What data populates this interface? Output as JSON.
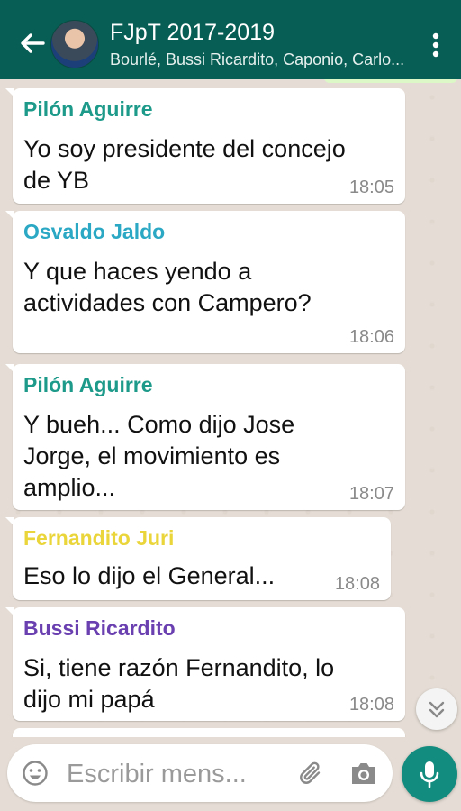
{
  "header": {
    "title": "FJpT 2017-2019",
    "subtitle": "Bourlé, Bussi Ricardito, Caponio, Carlo..."
  },
  "messages": [
    {
      "sender": "Pilón Aguirre",
      "sender_color": "#1e9a8a",
      "text_lines": [
        "Yo soy presidente del concejo",
        "de YB"
      ],
      "time": "18:05"
    },
    {
      "sender": "Osvaldo Jaldo",
      "sender_color": "#2aa8c4",
      "text_lines": [
        "Y que haces yendo a",
        "actividades con Campero?"
      ],
      "time": "18:06"
    },
    {
      "sender": "Pilón Aguirre",
      "sender_color": "#1e9a8a",
      "text_lines": [
        "Y bueh... Como dijo Jose",
        "Jorge, el movimiento es",
        "amplio..."
      ],
      "time": "18:07"
    },
    {
      "sender": "Fernandito Juri",
      "sender_color": "#ead53a",
      "text_lines": [
        "Eso lo dijo el General..."
      ],
      "time": "18:08"
    },
    {
      "sender": "Bussi Ricardito",
      "sender_color": "#6a3fb0",
      "text_lines": [
        "Si, tiene razón Fernandito, lo",
        "dijo mi papá"
      ],
      "time": "18:08"
    }
  ],
  "composer": {
    "placeholder": "Escribir mens...",
    "value": ""
  },
  "icons": {
    "back": "back-arrow-icon",
    "menu": "more-vert-icon",
    "emoji": "emoji-icon",
    "attach": "paperclip-icon",
    "camera": "camera-icon",
    "mic": "microphone-icon",
    "scroll": "chevron-double-down-icon"
  },
  "colors": {
    "header": "#075e54",
    "accent": "#128c7e",
    "chat_bg": "#e5ddd5"
  }
}
